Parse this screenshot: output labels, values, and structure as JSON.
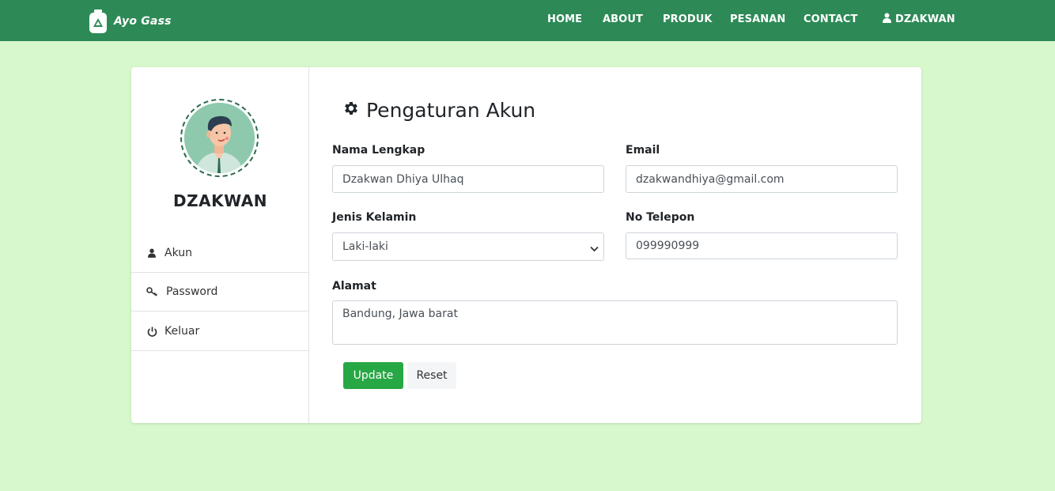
{
  "navbar": {
    "brand": "Ayo Gass",
    "links": [
      "HOME",
      "ABOUT",
      "PRODUK",
      "PESANAN",
      "CONTACT"
    ],
    "user": "DZAKWAN",
    "bg_color": "#2d8a56"
  },
  "sidebar": {
    "username": "DZAKWAN",
    "items": [
      {
        "label": "Akun",
        "icon": "user-icon"
      },
      {
        "label": "Password",
        "icon": "key-icon"
      },
      {
        "label": "Keluar",
        "icon": "power-icon"
      }
    ]
  },
  "form": {
    "title": "Pengaturan Akun",
    "title_icon": "gear-icon",
    "fields": {
      "nama": {
        "label": "Nama Lengkap",
        "value": "Dzakwan Dhiya Ulhaq"
      },
      "email": {
        "label": "Email",
        "value": "dzakwandhiya@gmail.com"
      },
      "gender": {
        "label": "Jenis Kelamin",
        "value": "Laki-laki"
      },
      "phone": {
        "label": "No Telepon",
        "value": "099990999"
      },
      "alamat": {
        "label": "Alamat",
        "value": "Bandung, Jawa barat"
      }
    },
    "buttons": {
      "update": "Update",
      "reset": "Reset"
    }
  },
  "colors": {
    "page_bg": "#d7f8cc",
    "accent": "#2d8a56",
    "update_button": "#28a745"
  }
}
